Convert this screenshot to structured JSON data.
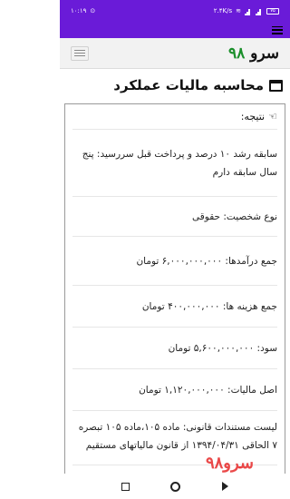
{
  "status_bar": {
    "time": "۱۰:۱۹",
    "speed": "۲.۴K/s",
    "battery": "۷۵"
  },
  "brand": {
    "name": "سرو",
    "number": "۹۸"
  },
  "page_title": "محاسبه مالیات عملکرد",
  "result": {
    "heading": "نتیجه:",
    "rows": [
      "سابقه رشد ۱۰ درصد و پرداخت قبل سررسید: پنج سال سابقه دارم",
      "نوع شخصیت: حقوقی",
      "جمع درآمدها: ۶,۰۰۰,۰۰۰,۰۰۰ تومان",
      "جمع هزینه ها: ۴۰۰,۰۰۰,۰۰۰ تومان",
      "سود: ۵,۶۰۰,۰۰۰,۰۰۰ تومان",
      "اصل مالیات: ۱,۱۲۰,۰۰۰,۰۰۰ تومان",
      "لیست مستندات قانونی: ماده ۱۰۵،ماده ۱۰۵ تبصره ۷ الحاقی ۱۳۹۴/۰۴/۳۱ از قانون مالیاتهای مستقیم"
    ]
  },
  "watermark": "سرو۹۸",
  "colors": {
    "accent": "#6a1bd8",
    "brand_number": "#1a8f2a",
    "watermark": "#e62828"
  }
}
